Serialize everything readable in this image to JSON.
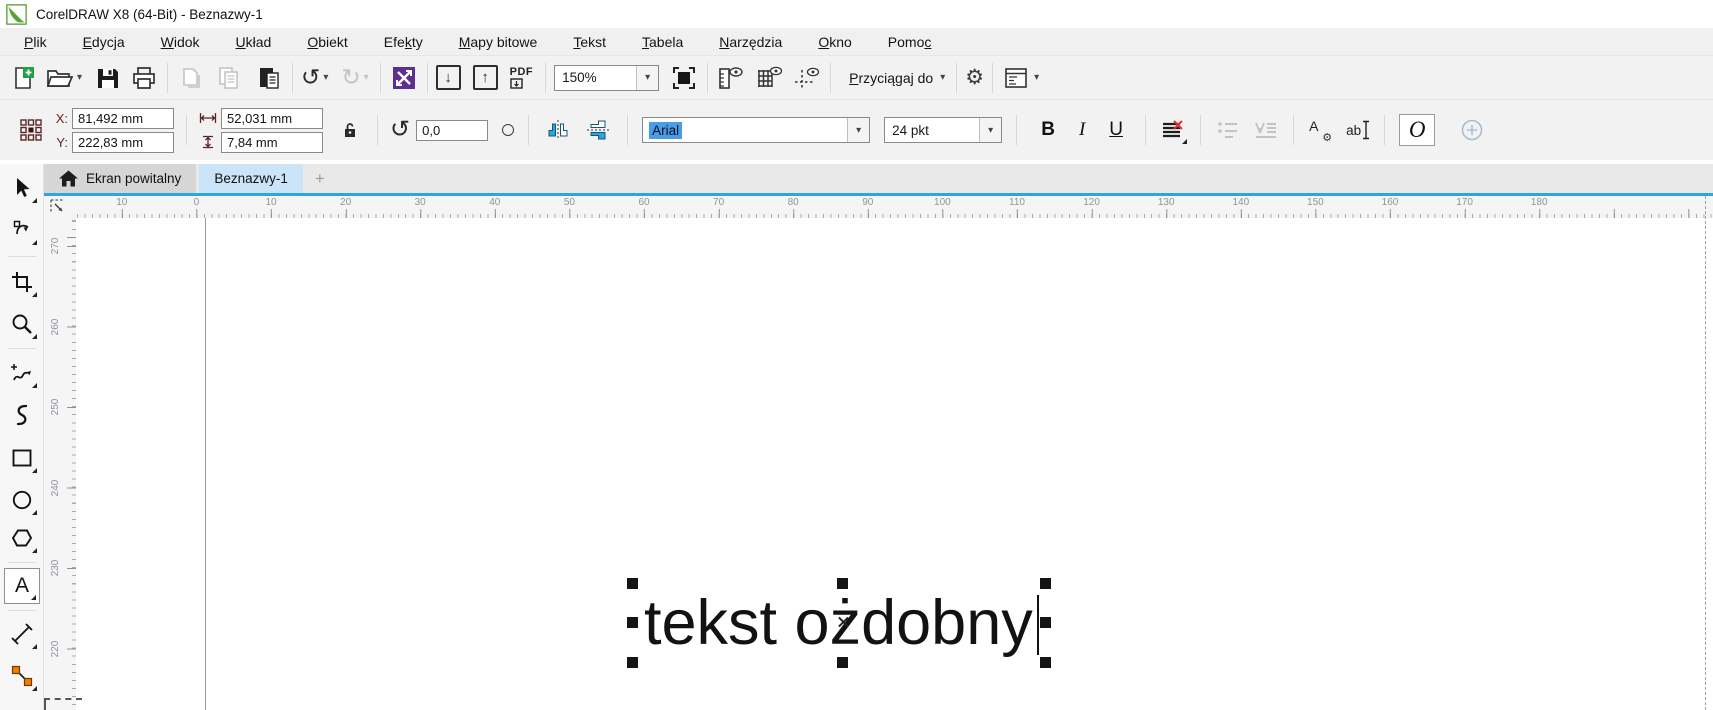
{
  "window": {
    "title": "CorelDRAW X8 (64-Bit) - Beznazwy-1"
  },
  "menu": {
    "items": [
      {
        "label": "Plik",
        "u": 0
      },
      {
        "label": "Edycja",
        "u": 0
      },
      {
        "label": "Widok",
        "u": 0
      },
      {
        "label": "Układ",
        "u": 0
      },
      {
        "label": "Obiekt",
        "u": 0
      },
      {
        "label": "Efekty",
        "u": 3
      },
      {
        "label": "Mapy bitowe",
        "u": 0
      },
      {
        "label": "Tekst",
        "u": 0
      },
      {
        "label": "Tabela",
        "u": 0
      },
      {
        "label": "Narzędzia",
        "u": 0
      },
      {
        "label": "Okno",
        "u": 0
      },
      {
        "label": "Pomoc",
        "u": 4
      }
    ]
  },
  "toolbar": {
    "zoom_level": "150%",
    "snap_label": "Przyciągaj do",
    "pdf_label": "PDF"
  },
  "property_bar": {
    "x_label": "X:",
    "x_value": "81,492 mm",
    "y_label": "Y:",
    "y_value": "222,83 mm",
    "width_value": "52,031 mm",
    "height_value": "7,84 mm",
    "rotation_value": "0,0",
    "font_name": "Arial",
    "font_size": "24 pkt",
    "bold_label": "B",
    "italic_label": "I",
    "underline_label": "U",
    "char_format_label": "A",
    "edit_text_label": "ab",
    "opentype_label": "O"
  },
  "tabs": {
    "welcome_label": "Ekran powitalny",
    "document_label": "Beznazwy-1",
    "new_tab_label": "+"
  },
  "rulers": {
    "horizontal_labels": [
      "10",
      "0",
      "10",
      "20",
      "30",
      "40",
      "50",
      "60",
      "70",
      "80",
      "90",
      "100",
      "110",
      "120",
      "130",
      "140",
      "150",
      "160",
      "170",
      "180"
    ],
    "vertical_labels": [
      "270",
      "260",
      "250",
      "240",
      "230",
      "220"
    ]
  },
  "canvas": {
    "text_object": "tekst ożdobny"
  },
  "icons": {
    "dropdown": "▾",
    "undo": "↺",
    "redo": "↻",
    "gear": "⚙",
    "import_arrow": "↓",
    "export_arrow": "↑",
    "text_tool": "A"
  },
  "colors": {
    "tab_active_blue": "#cbe4f8",
    "canvas_divider_blue": "#2ca6df",
    "font_selection_blue": "#4a9be8",
    "launcher_purple": "#5c2f91",
    "new_doc_green": "#22a043",
    "connector_orange": "#f07d00",
    "no_align_red": "#e03131"
  }
}
